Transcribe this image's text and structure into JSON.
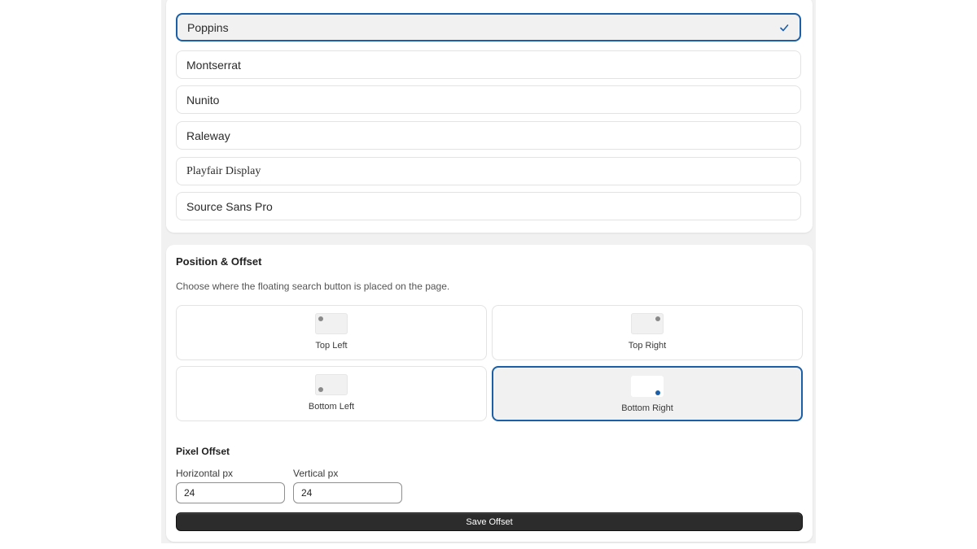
{
  "fonts": {
    "options": [
      {
        "label": "Poppins",
        "selected": true
      },
      {
        "label": "Montserrat",
        "selected": false
      },
      {
        "label": "Nunito",
        "selected": false
      },
      {
        "label": "Raleway",
        "selected": false
      },
      {
        "label": "Playfair Display",
        "selected": false
      },
      {
        "label": "Source Sans Pro",
        "selected": false
      }
    ]
  },
  "position": {
    "title": "Position & Offset",
    "description": "Choose where the floating search button is placed on the page.",
    "options": [
      {
        "label": "Top Left",
        "selected": false
      },
      {
        "label": "Top Right",
        "selected": false
      },
      {
        "label": "Bottom Left",
        "selected": false
      },
      {
        "label": "Bottom Right",
        "selected": true
      }
    ]
  },
  "offset": {
    "title": "Pixel Offset",
    "horizontal_label": "Horizontal px",
    "horizontal_value": "24",
    "vertical_label": "Vertical px",
    "vertical_value": "24",
    "save_label": "Save Offset"
  },
  "colors": {
    "accent": "#1b5fa8",
    "button_bg": "#2c2c2c",
    "page_bg": "#f1f1f1"
  }
}
